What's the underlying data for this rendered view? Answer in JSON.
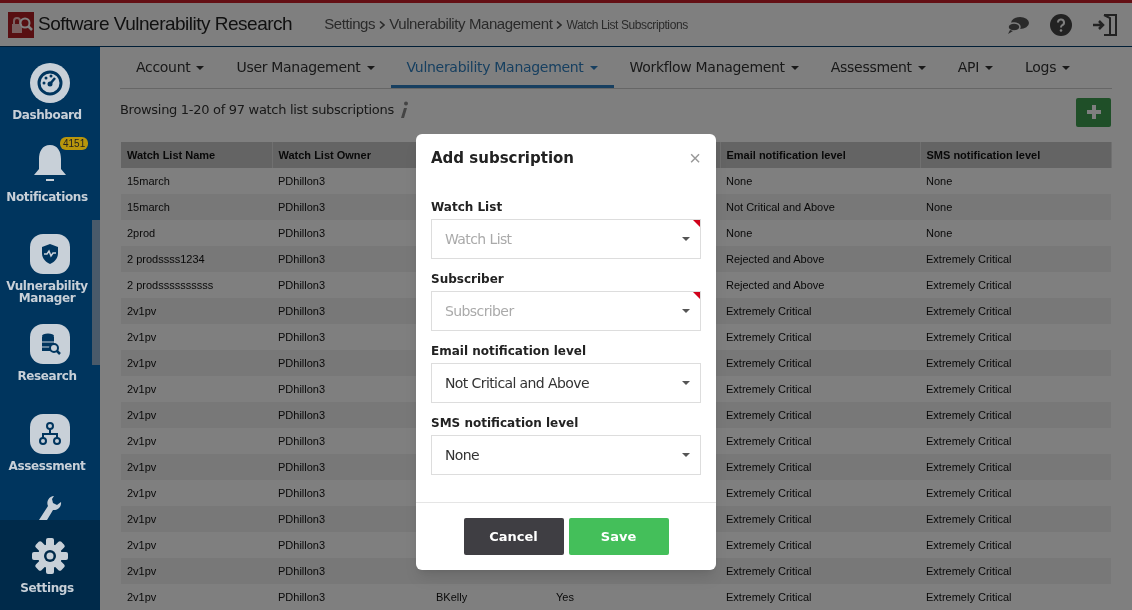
{
  "app": {
    "title": "Software Vulnerability Research"
  },
  "breadcrumb": [
    {
      "label": "Settings"
    },
    {
      "label": "Vulnerability Management"
    },
    {
      "label": "Watch List Subscriptions"
    }
  ],
  "sidebar": {
    "items": [
      {
        "kind": "dashboard",
        "label": "Dashboard",
        "selected": false
      },
      {
        "kind": "bell",
        "label": "Notifications",
        "badge": "4151",
        "selected": false
      },
      {
        "kind": "shield",
        "label": "Vulnerability Manager",
        "selected": false
      },
      {
        "kind": "research",
        "label": "Research",
        "selected": false
      },
      {
        "kind": "tree",
        "label": "Assessment",
        "selected": false
      },
      {
        "kind": "wrench",
        "selected": false
      },
      {
        "kind": "gear",
        "label": "Settings",
        "selected": true
      }
    ]
  },
  "tabs": [
    {
      "label": "Account",
      "selected": false
    },
    {
      "label": "User Management",
      "selected": false
    },
    {
      "label": "Vulnerability Management",
      "selected": true
    },
    {
      "label": "Workflow Management",
      "selected": false
    },
    {
      "label": "Assessment",
      "selected": false
    },
    {
      "label": "API",
      "selected": false
    },
    {
      "label": "Logs",
      "selected": false
    }
  ],
  "summary": "Browsing 1-20 of 97 watch list subscriptions",
  "table": {
    "columns": [
      "Watch List Name",
      "Watch List Owner",
      "Email notification level",
      "SMS notification level"
    ],
    "rows": [
      {
        "name": "15march",
        "owner": "PDhillon3",
        "email": "None",
        "sms": "None"
      },
      {
        "name": "15march",
        "owner": "PDhillon3",
        "email": "Not Critical and Above",
        "sms": "None"
      },
      {
        "name": "2prod",
        "owner": "PDhillon3",
        "email": "None",
        "sms": "None"
      },
      {
        "name": "2 prodssss1234",
        "owner": "PDhillon3",
        "email": "Rejected and Above",
        "sms": "Extremely Critical"
      },
      {
        "name": "2 prodssssssssss",
        "owner": "PDhillon3",
        "email": "Rejected and Above",
        "sms": "Extremely Critical"
      },
      {
        "name": "2v1pv",
        "owner": "PDhillon3",
        "email": "Extremely Critical",
        "sms": "Extremely Critical"
      },
      {
        "name": "2v1pv",
        "owner": "PDhillon3",
        "email": "Extremely Critical",
        "sms": "Extremely Critical"
      },
      {
        "name": "2v1pv",
        "owner": "PDhillon3",
        "email": "Extremely Critical",
        "sms": "Extremely Critical"
      },
      {
        "name": "2v1pv",
        "owner": "PDhillon3",
        "email": "Extremely Critical",
        "sms": "Extremely Critical"
      },
      {
        "name": "2v1pv",
        "owner": "PDhillon3",
        "email": "Extremely Critical",
        "sms": "Extremely Critical"
      },
      {
        "name": "2v1pv",
        "owner": "PDhillon3",
        "email": "Extremely Critical",
        "sms": "Extremely Critical"
      },
      {
        "name": "2v1pv",
        "owner": "PDhillon3",
        "email": "Extremely Critical",
        "sms": "Extremely Critical"
      },
      {
        "name": "2v1pv",
        "owner": "PDhillon3",
        "email": "Extremely Critical",
        "sms": "Extremely Critical"
      },
      {
        "name": "2v1pv",
        "owner": "PDhillon3",
        "email": "Extremely Critical",
        "sms": "Extremely Critical"
      },
      {
        "name": "2v1pv",
        "owner": "PDhillon3",
        "email": "Extremely Critical",
        "sms": "Extremely Critical"
      },
      {
        "name": "2v1pv",
        "owner": "PDhillon3",
        "email": "Extremely Critical",
        "sms": "Extremely Critical"
      },
      {
        "name": "2v1pv",
        "owner": "PDhillon3",
        "column_3": "BKelly",
        "column_4": "Yes",
        "email": "Extremely Critical",
        "sms": "Extremely Critical"
      }
    ]
  },
  "dialog": {
    "title": "Add subscription",
    "close": "×",
    "fields": [
      {
        "label": "Watch List",
        "placeholder": "Watch List",
        "required": true
      },
      {
        "label": "Subscriber",
        "placeholder": "Subscriber",
        "required": true
      },
      {
        "label": "Email notification level",
        "value": "Not Critical and Above",
        "required": false
      },
      {
        "label": "SMS notification level",
        "value": "None",
        "required": false
      }
    ],
    "buttons": [
      {
        "kind": "cancel",
        "label": "Cancel"
      },
      {
        "kind": "save",
        "label": "Save"
      }
    ]
  }
}
